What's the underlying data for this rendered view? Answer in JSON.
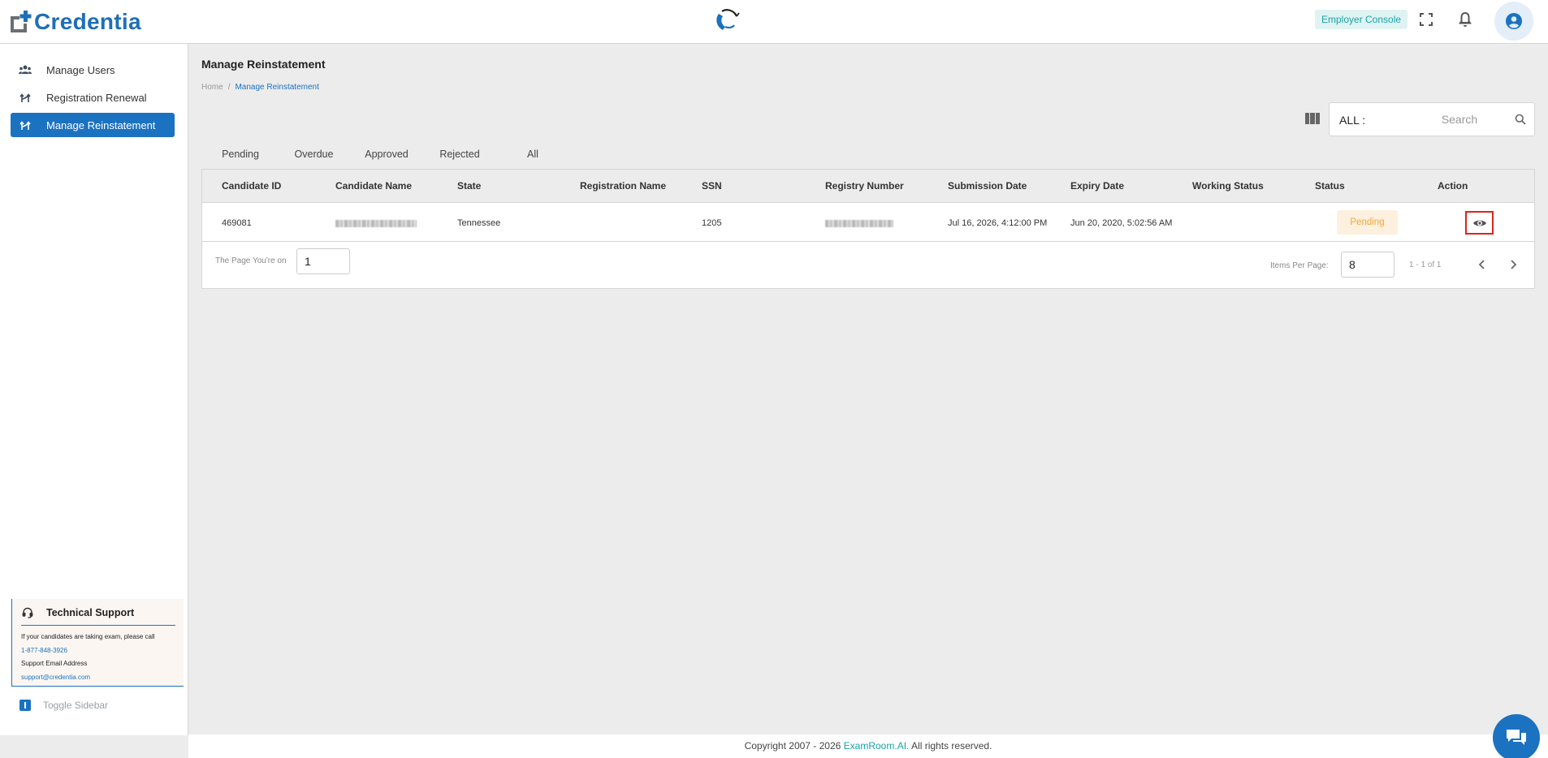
{
  "app": {
    "logo_text": "Credentia",
    "employer_console_label": "Employer Console"
  },
  "icons": {
    "fullscreen": "fullscreen-icon",
    "bell": "bell-icon",
    "user": "account-circle-icon",
    "search": "search-icon",
    "columns": "columns-icon",
    "eye": "eye-icon",
    "chat": "chat-icon"
  },
  "colors": {
    "brand": "#1b72c0",
    "accent_teal": "#1aa3a8",
    "pending_bg": "#fdf0de",
    "pending_fg": "#f0a73a"
  },
  "sidebar": {
    "items": [
      {
        "label": "Manage Users",
        "icon": "users-icon",
        "active": false
      },
      {
        "label": "Registration Renewal",
        "icon": "route-icon",
        "active": false
      },
      {
        "label": "Manage Reinstatement",
        "icon": "route-icon",
        "active": true
      }
    ],
    "support": {
      "title": "Technical Support",
      "line1": "If your candidates are taking exam, please call",
      "phone": "1-877-848-3926",
      "email_label": "Support Email Address",
      "email": "support@credentia.com"
    },
    "toggle_label": "Toggle Sidebar"
  },
  "main": {
    "title": "Manage Reinstatement",
    "breadcrumb": {
      "home": "Home",
      "separator": "/",
      "current": "Manage Reinstatement"
    },
    "search": {
      "scope": "ALL :",
      "placeholder": "Search"
    },
    "tabs": [
      {
        "label": "Pending",
        "active": true
      },
      {
        "label": "Overdue",
        "active": false
      },
      {
        "label": "Approved",
        "active": false
      },
      {
        "label": "Rejected",
        "active": false
      },
      {
        "label": "All",
        "active": false
      }
    ],
    "table": {
      "headers": [
        "Candidate ID",
        "Candidate Name",
        "State",
        "Registration Name",
        "SSN",
        "Registry Number",
        "Submission Date",
        "Expiry Date",
        "Working Status",
        "Status",
        "Action"
      ],
      "rows": [
        {
          "candidate_id": "469081",
          "candidate_name": "",
          "state": "Tennessee",
          "registration_name": "",
          "ssn": "1205",
          "registry_number": "",
          "submission_date": "Jul 16, 2026, 4:12:00 PM",
          "expiry_date": "Jun 20, 2020, 5:02:56 AM",
          "working_status": "",
          "status": "Pending"
        }
      ]
    },
    "pagination": {
      "page_label": "The Page You're on",
      "page_value": "1",
      "items_per_page_label": "Items Per Page:",
      "items_per_page_value": "8",
      "range": "1 -  1 of 1"
    }
  },
  "footer": {
    "prefix": "Copyright 2007 - 2026 ",
    "brand": "ExamRoom.AI.",
    "suffix": " All rights reserved."
  }
}
